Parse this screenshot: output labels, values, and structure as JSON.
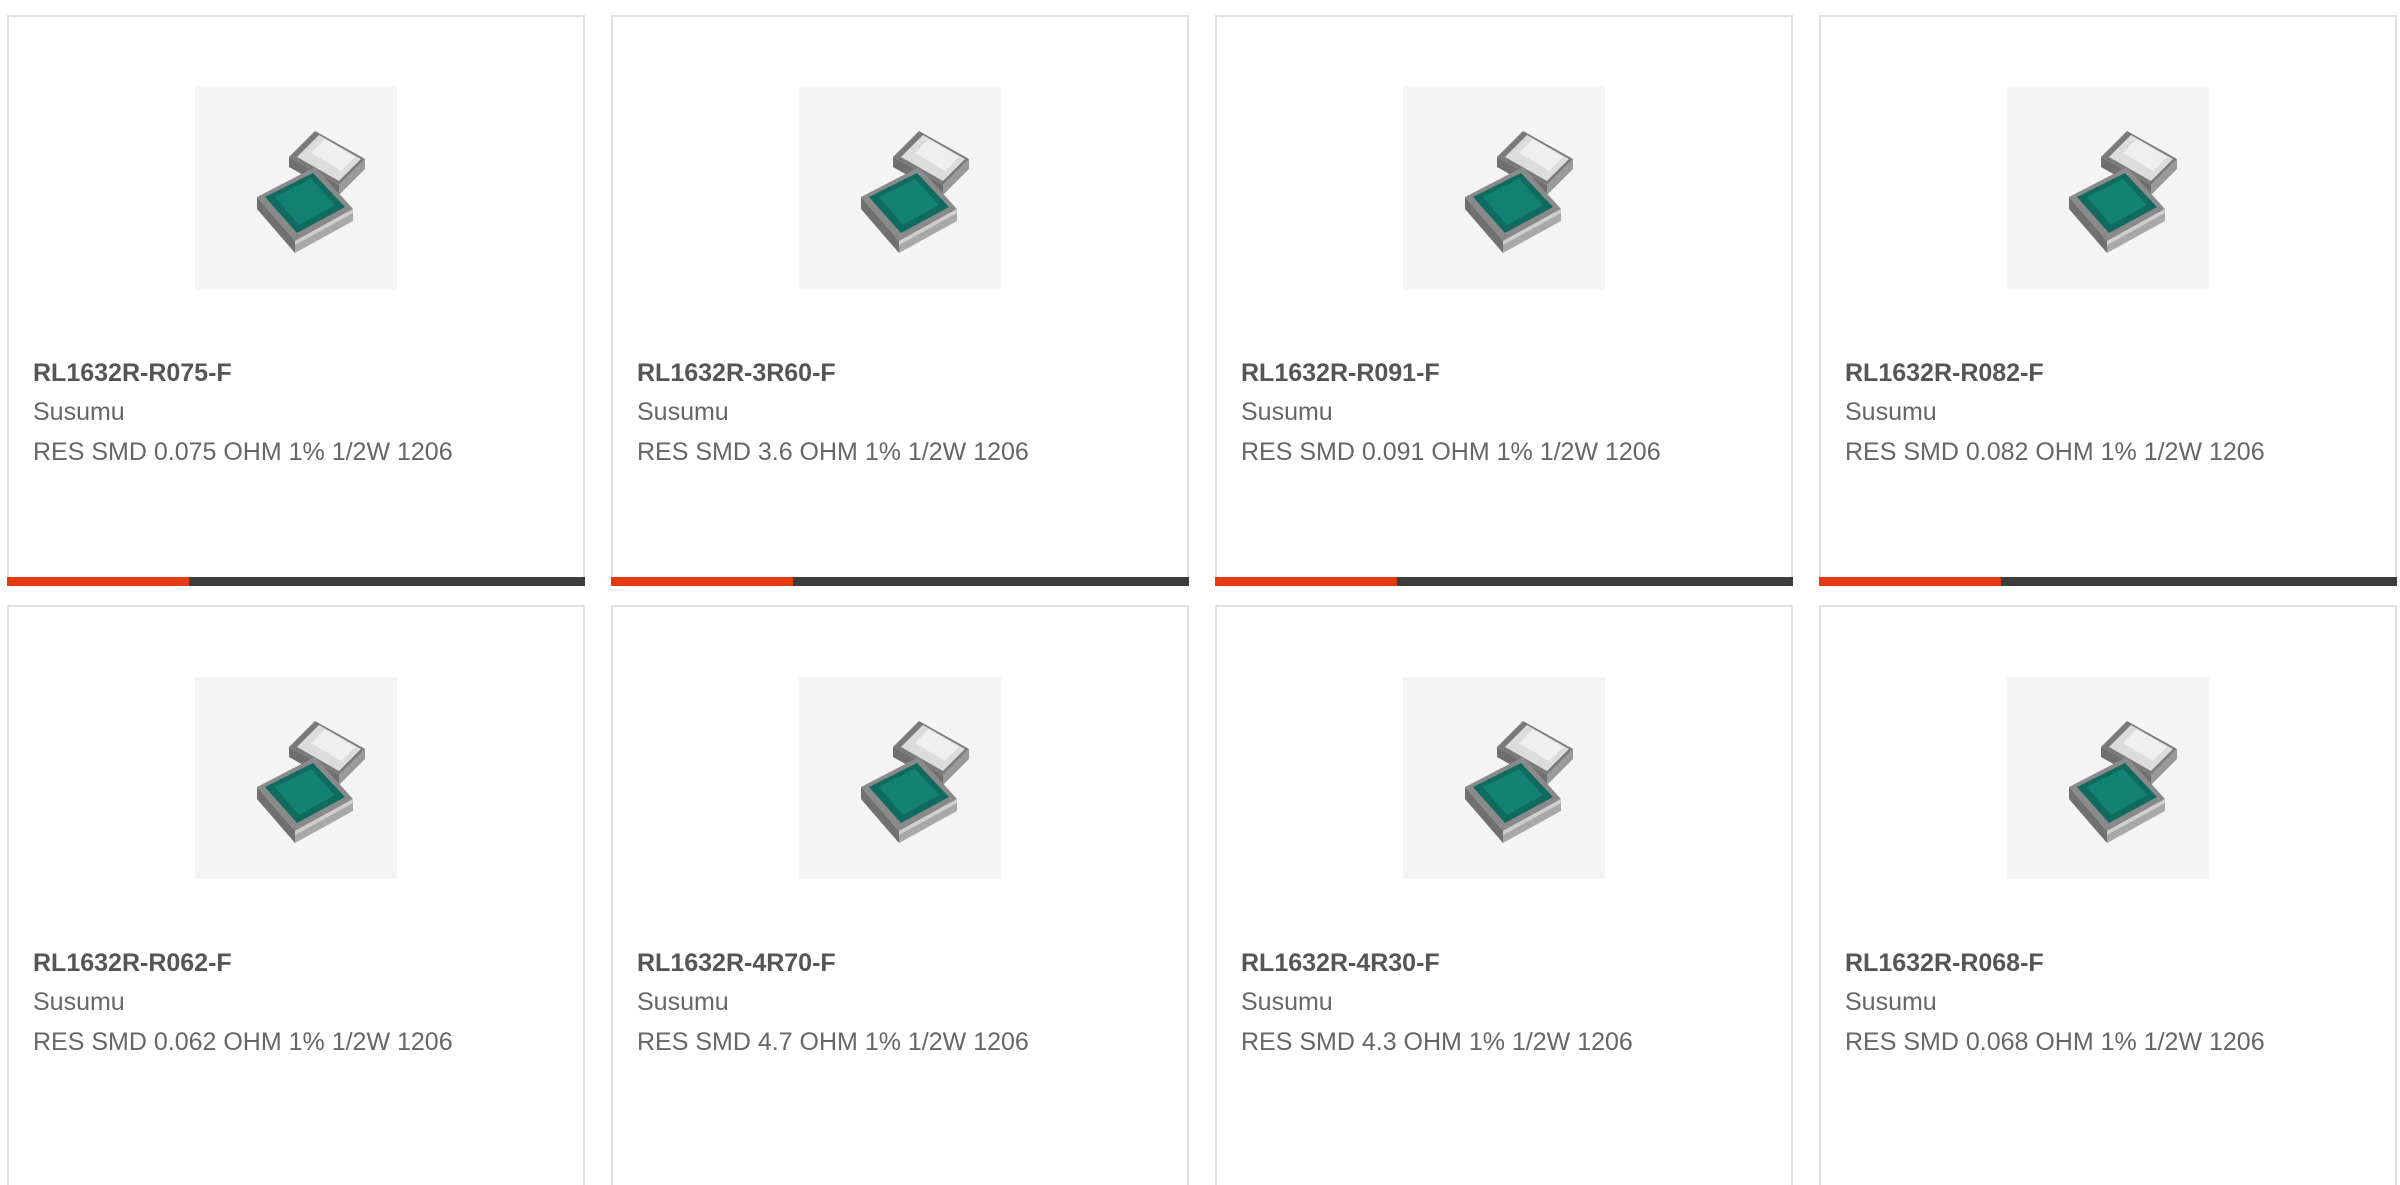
{
  "colors": {
    "accent": "#e43a0f",
    "bar_track": "#3d3d3d",
    "card_border": "#e1e1e1",
    "title_text": "#555555",
    "body_text": "#666666",
    "resistor_body": "#0f6b5f"
  },
  "product_image_icon": "smd-resistor-chip-icon",
  "products": [
    {
      "part_number": "RL1632R-R075-F",
      "manufacturer": "Susumu",
      "description": "RES SMD 0.075 OHM 1% 1/2W 1206",
      "progress": 0.315
    },
    {
      "part_number": "RL1632R-3R60-F",
      "manufacturer": "Susumu",
      "description": "RES SMD 3.6 OHM 1% 1/2W 1206",
      "progress": 0.315
    },
    {
      "part_number": "RL1632R-R091-F",
      "manufacturer": "Susumu",
      "description": "RES SMD 0.091 OHM 1% 1/2W 1206",
      "progress": 0.315
    },
    {
      "part_number": "RL1632R-R082-F",
      "manufacturer": "Susumu",
      "description": "RES SMD 0.082 OHM 1% 1/2W 1206",
      "progress": 0.315
    },
    {
      "part_number": "RL1632R-R062-F",
      "manufacturer": "Susumu",
      "description": "RES SMD 0.062 OHM 1% 1/2W 1206",
      "progress": null
    },
    {
      "part_number": "RL1632R-4R70-F",
      "manufacturer": "Susumu",
      "description": "RES SMD 4.7 OHM 1% 1/2W 1206",
      "progress": null
    },
    {
      "part_number": "RL1632R-4R30-F",
      "manufacturer": "Susumu",
      "description": "RES SMD 4.3 OHM 1% 1/2W 1206",
      "progress": null
    },
    {
      "part_number": "RL1632R-R068-F",
      "manufacturer": "Susumu",
      "description": "RES SMD 0.068 OHM 1% 1/2W 1206",
      "progress": null
    }
  ]
}
